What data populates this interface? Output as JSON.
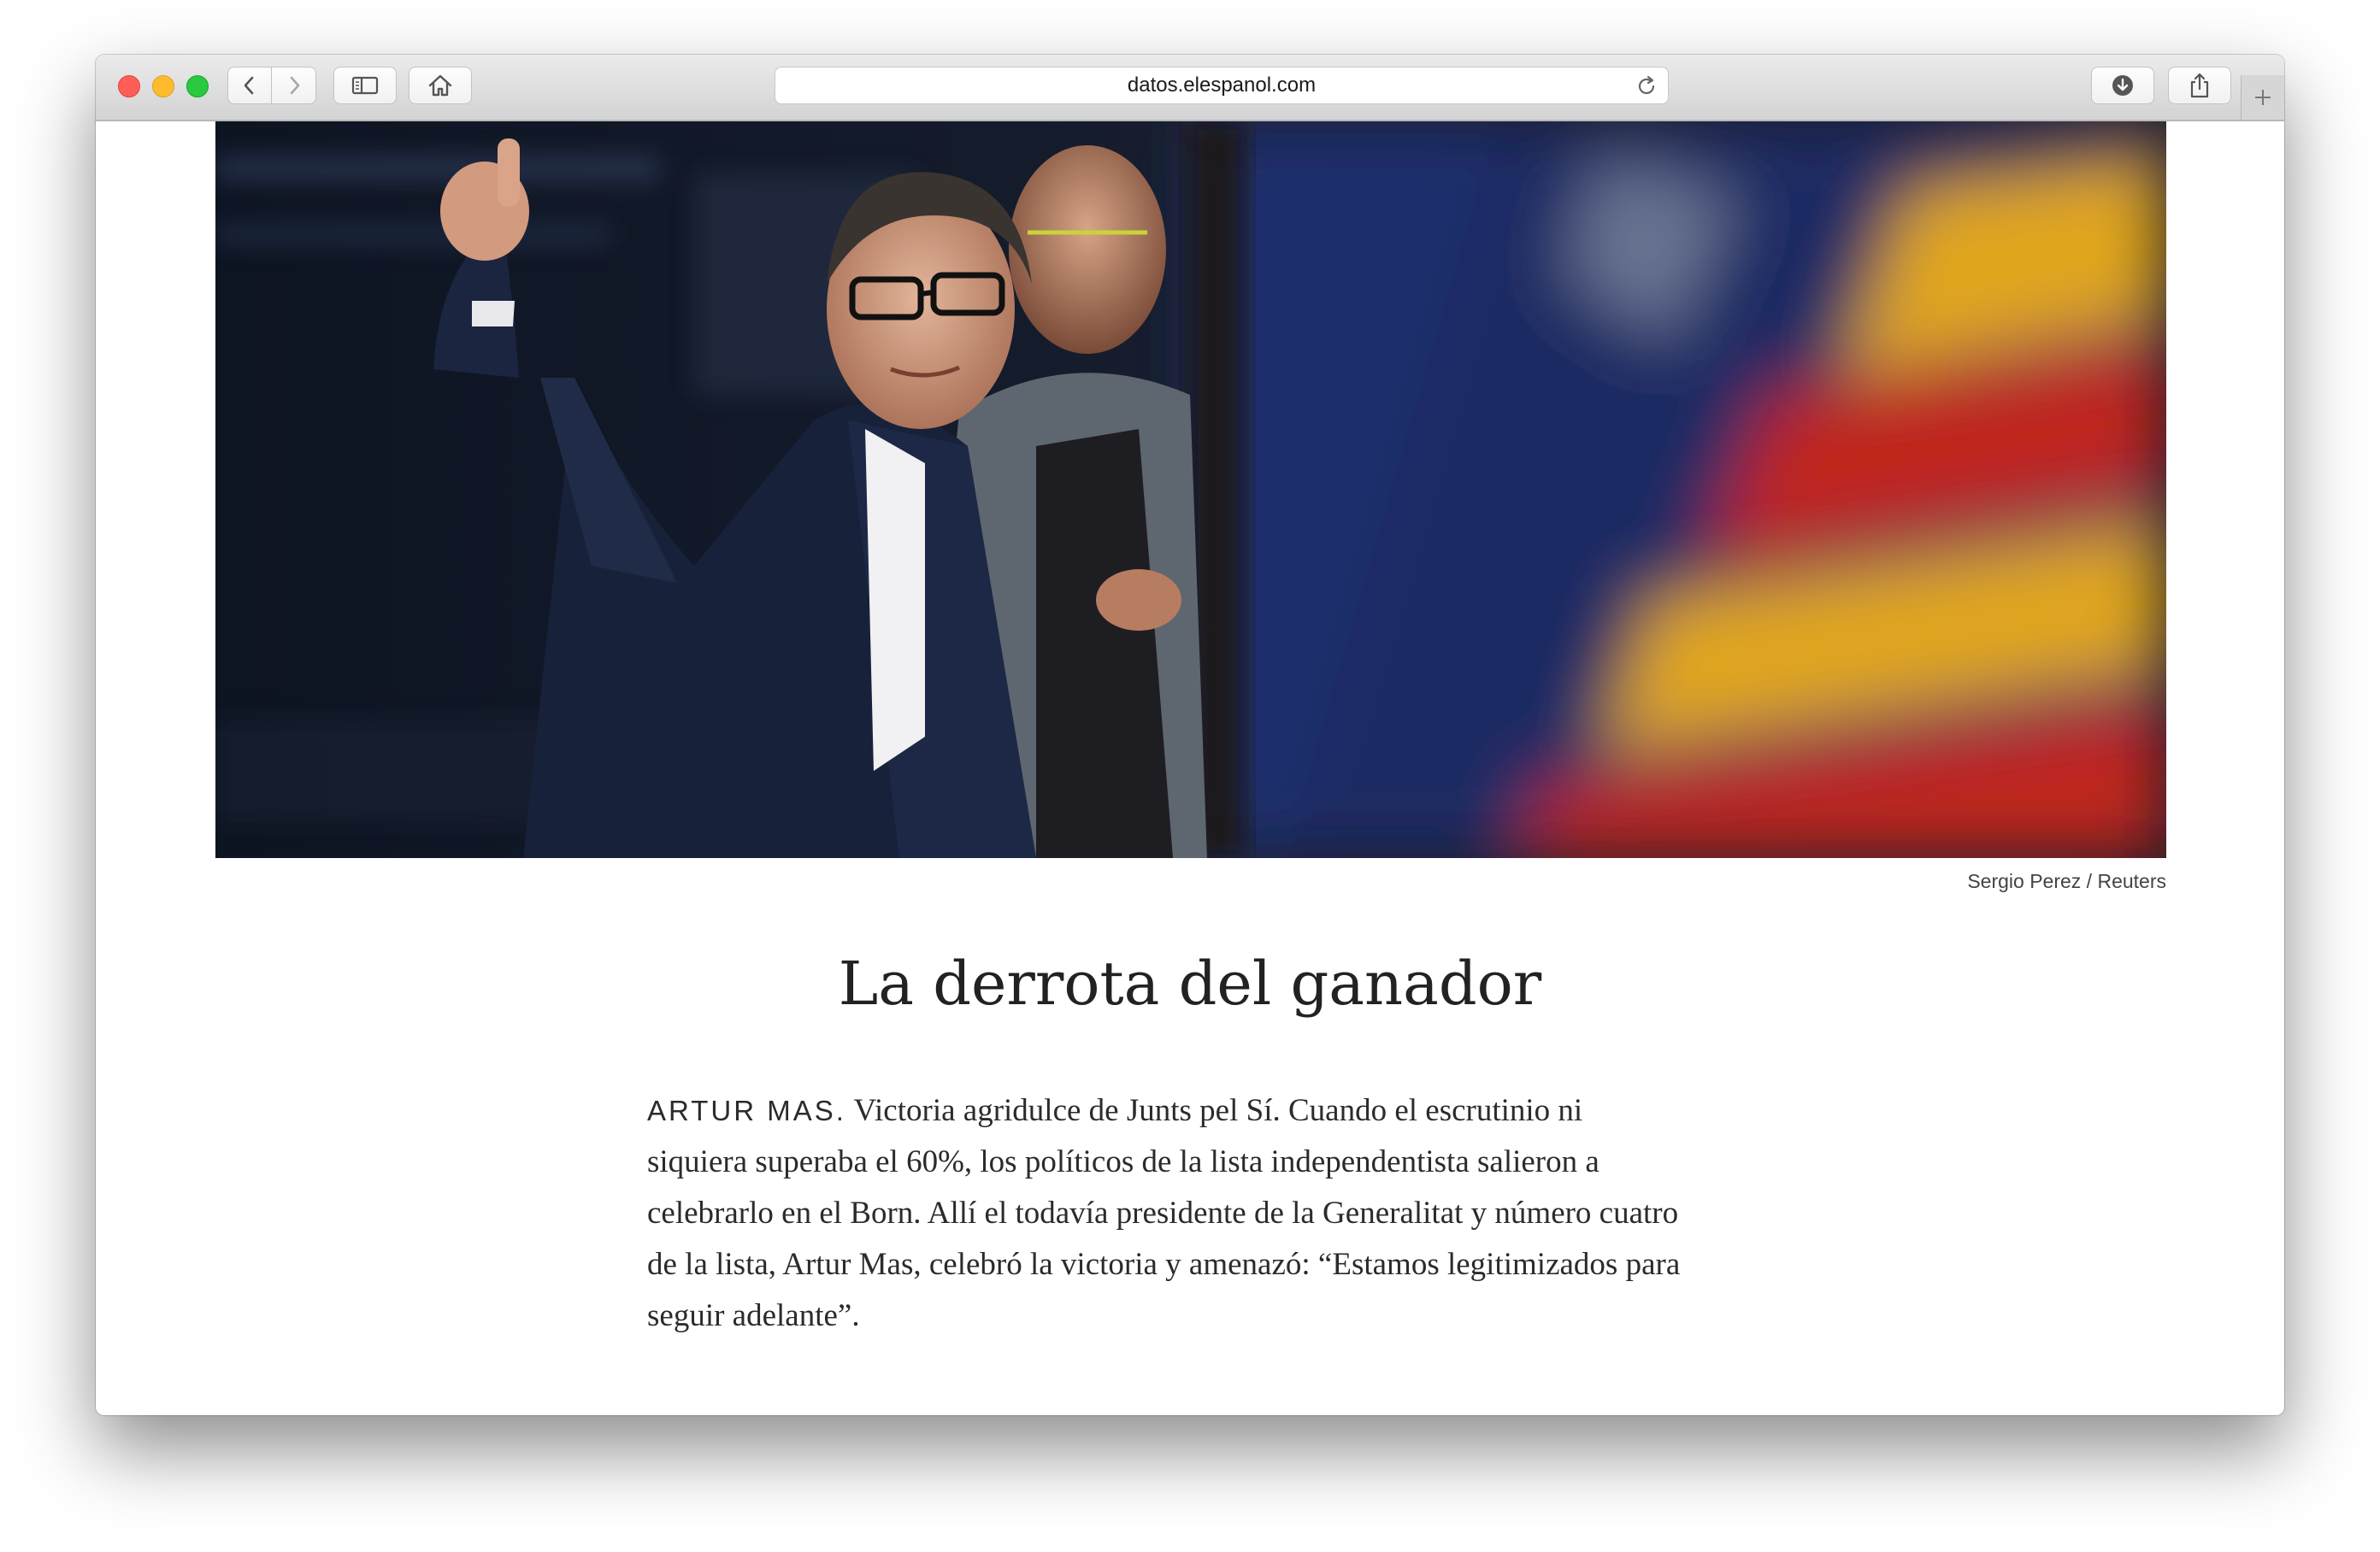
{
  "browser": {
    "url": "datos.elespanol.com"
  },
  "icons": {
    "back": "chevron-left-icon",
    "forward": "chevron-right-icon",
    "sidebar": "sidebar-icon",
    "home": "home-icon",
    "reload": "reload-icon",
    "download": "download-icon",
    "share": "share-icon",
    "new_tab": "plus-icon"
  },
  "article": {
    "photo_credit": "Sergio Perez / Reuters",
    "title": "La derrota del ganador",
    "lead_in": "ARTUR MAS.",
    "body": "Victoria agridulce de Junts pel Sí. Cuando el escrutinio ni siquiera superaba el 60%, los políticos de la lista independentista salieron a celebrarlo en el Born. Allí el todavía presidente de la Generalitat y número cuatro de la lista, Artur Mas, celebró la victoria y amenazó: “Estamos legitimizados para seguir adelante”."
  },
  "colors": {
    "flag_red": "#c0261f",
    "flag_yellow": "#e0a61a",
    "flag_blue": "#1c2f6e",
    "text": "#222222"
  }
}
